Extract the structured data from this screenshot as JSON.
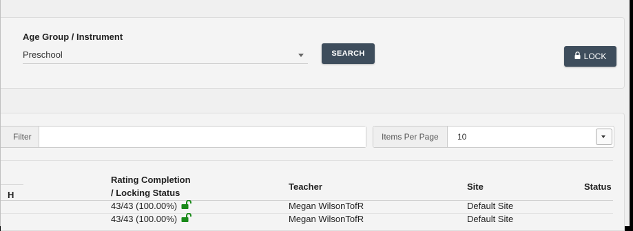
{
  "search_panel": {
    "age_group_label": "Age Group / Instrument",
    "age_group_value": "Preschool",
    "search_button": "SEARCH",
    "lock_button": "LOCK"
  },
  "table_controls": {
    "filter_label": "Filter",
    "filter_value": "",
    "items_per_page_label": "Items Per Page",
    "items_per_page_value": "10"
  },
  "table": {
    "columns": {
      "partial": "H",
      "rating_line1": "Rating Completion",
      "rating_line2": "/ Locking Status",
      "teacher": "Teacher",
      "site": "Site",
      "status": "Status"
    },
    "rows": [
      {
        "rating": "43/43 (100.00%)",
        "lock_status": "unlocked",
        "teacher": "Megan WilsonTofR",
        "site": "Default Site",
        "status": ""
      },
      {
        "rating": "43/43 (100.00%)",
        "lock_status": "unlocked",
        "teacher": "Megan WilsonTofR",
        "site": "Default Site",
        "status": ""
      }
    ]
  },
  "colors": {
    "button_bg": "#3e4d5c",
    "unlocked_icon": "#1a8a1a"
  }
}
